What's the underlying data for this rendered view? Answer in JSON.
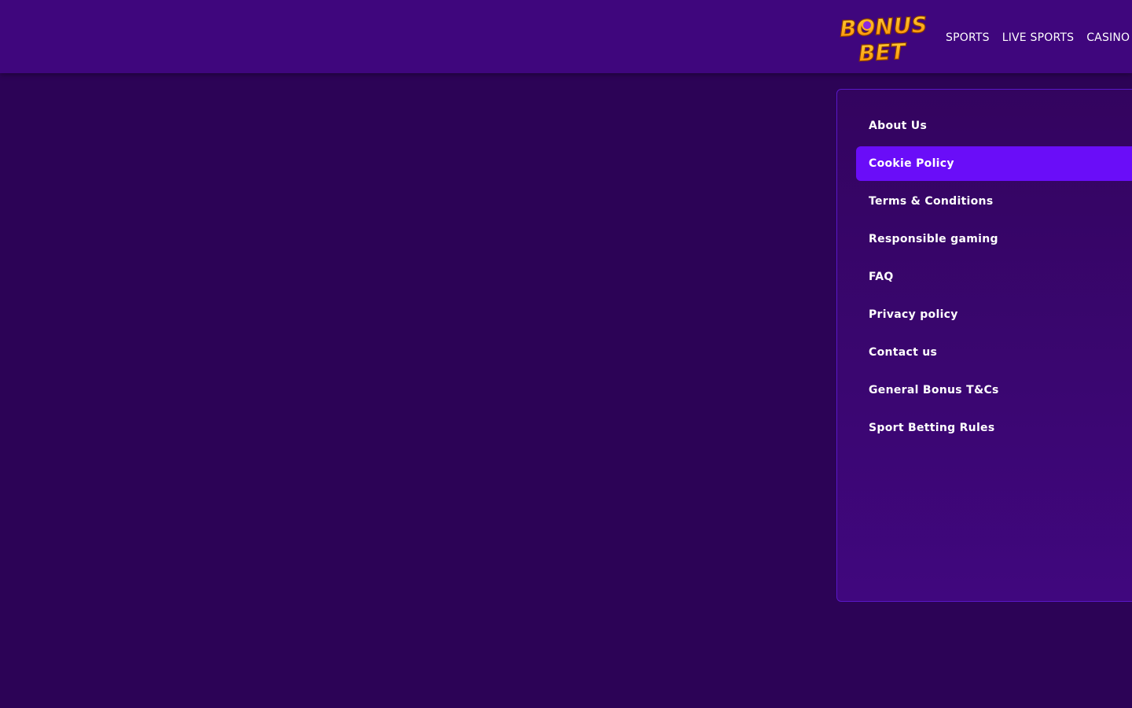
{
  "header": {
    "logo": {
      "icon": "bonus-bet-logo",
      "line1": "BONUS",
      "line2": "BET",
      "colors": [
        "#ffb21e",
        "#ff7a00",
        "#8a2be2"
      ]
    },
    "nav": [
      {
        "label": "SPORTS"
      },
      {
        "label": "LIVE SPORTS"
      },
      {
        "label": "CASINO"
      }
    ]
  },
  "info_menu": {
    "active_index": 1,
    "items": [
      {
        "label": "About Us"
      },
      {
        "label": "Cookie Policy"
      },
      {
        "label": "Terms & Conditions"
      },
      {
        "label": "Responsible gaming"
      },
      {
        "label": "FAQ"
      },
      {
        "label": "Privacy policy"
      },
      {
        "label": "Contact us"
      },
      {
        "label": "General Bonus T&Cs"
      },
      {
        "label": "Sport Betting Rules"
      }
    ]
  },
  "colors": {
    "background": "#2c0356",
    "header": "#3f067d",
    "active_item": "#6a0df8",
    "panel_border": "#5a18c8"
  }
}
